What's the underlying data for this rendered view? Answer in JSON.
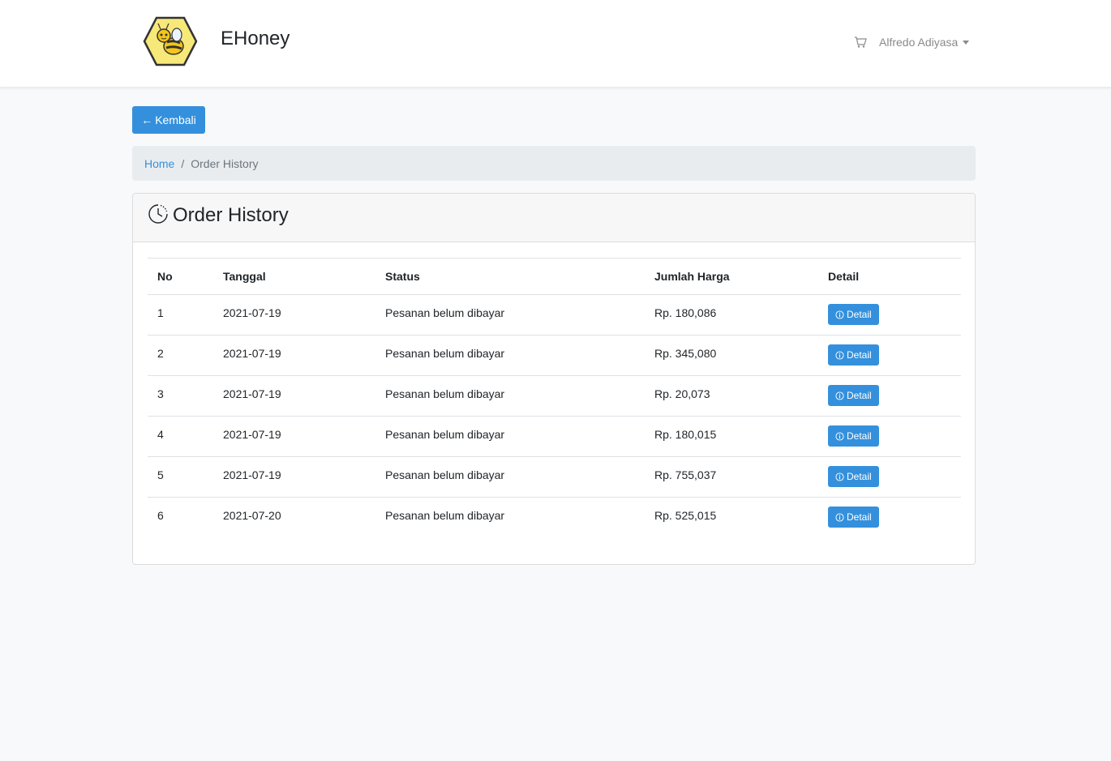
{
  "brand": {
    "name": "EHoney"
  },
  "nav": {
    "user_name": "Alfredo Adiyasa"
  },
  "back_button": {
    "label": "Kembali"
  },
  "breadcrumb": {
    "home": "Home",
    "current": "Order History"
  },
  "card": {
    "title": "Order History"
  },
  "table": {
    "headers": [
      "No",
      "Tanggal",
      "Status",
      "Jumlah Harga",
      "Detail"
    ],
    "rows": [
      {
        "no": "1",
        "date": "2021-07-19",
        "status": "Pesanan belum dibayar",
        "price": "Rp. 180,086",
        "detail": "Detail"
      },
      {
        "no": "2",
        "date": "2021-07-19",
        "status": "Pesanan belum dibayar",
        "price": "Rp. 345,080",
        "detail": "Detail"
      },
      {
        "no": "3",
        "date": "2021-07-19",
        "status": "Pesanan belum dibayar",
        "price": "Rp. 20,073",
        "detail": "Detail"
      },
      {
        "no": "4",
        "date": "2021-07-19",
        "status": "Pesanan belum dibayar",
        "price": "Rp. 180,015",
        "detail": "Detail"
      },
      {
        "no": "5",
        "date": "2021-07-19",
        "status": "Pesanan belum dibayar",
        "price": "Rp. 755,037",
        "detail": "Detail"
      },
      {
        "no": "6",
        "date": "2021-07-20",
        "status": "Pesanan belum dibayar",
        "price": "Rp. 525,015",
        "detail": "Detail"
      }
    ]
  },
  "colors": {
    "primary": "#3490dc",
    "logo_fill": "#f7e87a",
    "logo_stroke": "#333333"
  },
  "icons": {
    "logo": "bee-hexagon-icon",
    "cart": "cart-icon",
    "back": "arrow-left-icon",
    "clock": "clock-icon",
    "info": "info-circle-icon"
  }
}
